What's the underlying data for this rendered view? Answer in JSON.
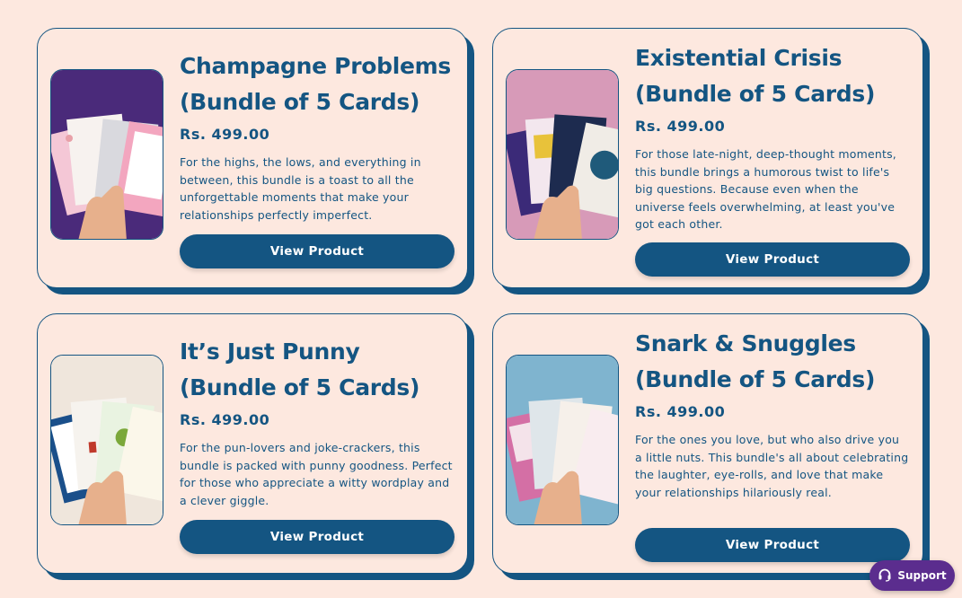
{
  "products": [
    {
      "title_line1": "Champagne Problems",
      "title_line2": "(Bundle of 5 Cards)",
      "price": "Rs. 499.00",
      "description": "For the highs, the lows, and everything in between, this bundle is a toast to all the unforgettable moments that make your relationships perfectly imperfect.",
      "button_label": "View Product"
    },
    {
      "title_line1": "Existential Crisis",
      "title_line2": "(Bundle of 5 Cards)",
      "price": "Rs. 499.00",
      "description": "For those late-night, deep-thought moments, this bundle brings a humorous twist to life's big questions. Because even when the universe feels overwhelming, at least you've got each other.",
      "button_label": "View Product"
    },
    {
      "title_line1": "It’s Just Punny",
      "title_line2": "(Bundle of 5 Cards)",
      "price": "Rs. 499.00",
      "description": "For the pun-lovers and joke-crackers, this bundle is packed with punny goodness. Perfect for those who appreciate a witty wordplay and a clever giggle.",
      "button_label": "View Product"
    },
    {
      "title_line1": "Snark & Snuggles",
      "title_line2": "(Bundle of 5 Cards)",
      "price": "Rs. 499.00",
      "description": "For the ones you love, but who also drive you a little nuts. This bundle's all about celebrating the laughter, eye-rolls, and love that make your relationships hilariously real.",
      "button_label": "View Product"
    }
  ],
  "support": {
    "label": "Support",
    "icon": "headset-icon"
  },
  "colors": {
    "page_bg": "#fde8df",
    "brand_blue": "#145582",
    "support_purple": "#5b2d8e"
  }
}
